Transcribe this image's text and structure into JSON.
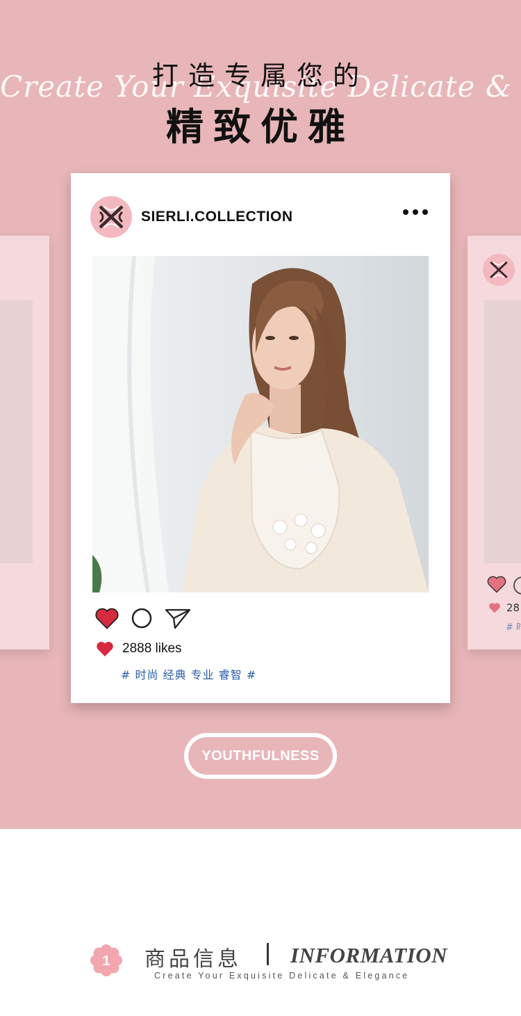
{
  "header": {
    "script_text": "Create Your Exquisite Delicate & Elegance",
    "title_line1": "打造专属您的",
    "title_line2": "精致优雅"
  },
  "post": {
    "account_name": "SIERLI.COLLECTION",
    "likes_text": "2888 likes",
    "tags": "# 时尚 经典 专业 睿智 #"
  },
  "right_card": {
    "likes_partial": "28",
    "tags_partial": "# 时"
  },
  "button": {
    "label": "YOUTHFULNESS"
  },
  "footer": {
    "number": "1",
    "cn_title": "商品信息",
    "en_title": "INFORMATION",
    "subtitle": "Create Your Exquisite Delicate & Elegance"
  },
  "colors": {
    "background_pink": "#e8b6b8",
    "card_side_pink": "#f5d9dc",
    "heart_red": "#d62a40",
    "tag_blue": "#2a5ea8",
    "logo_pink": "#f4b9c0"
  },
  "icons": [
    "heart-icon",
    "comment-icon",
    "share-icon",
    "more-icon",
    "brand-logo",
    "flower-badge"
  ]
}
